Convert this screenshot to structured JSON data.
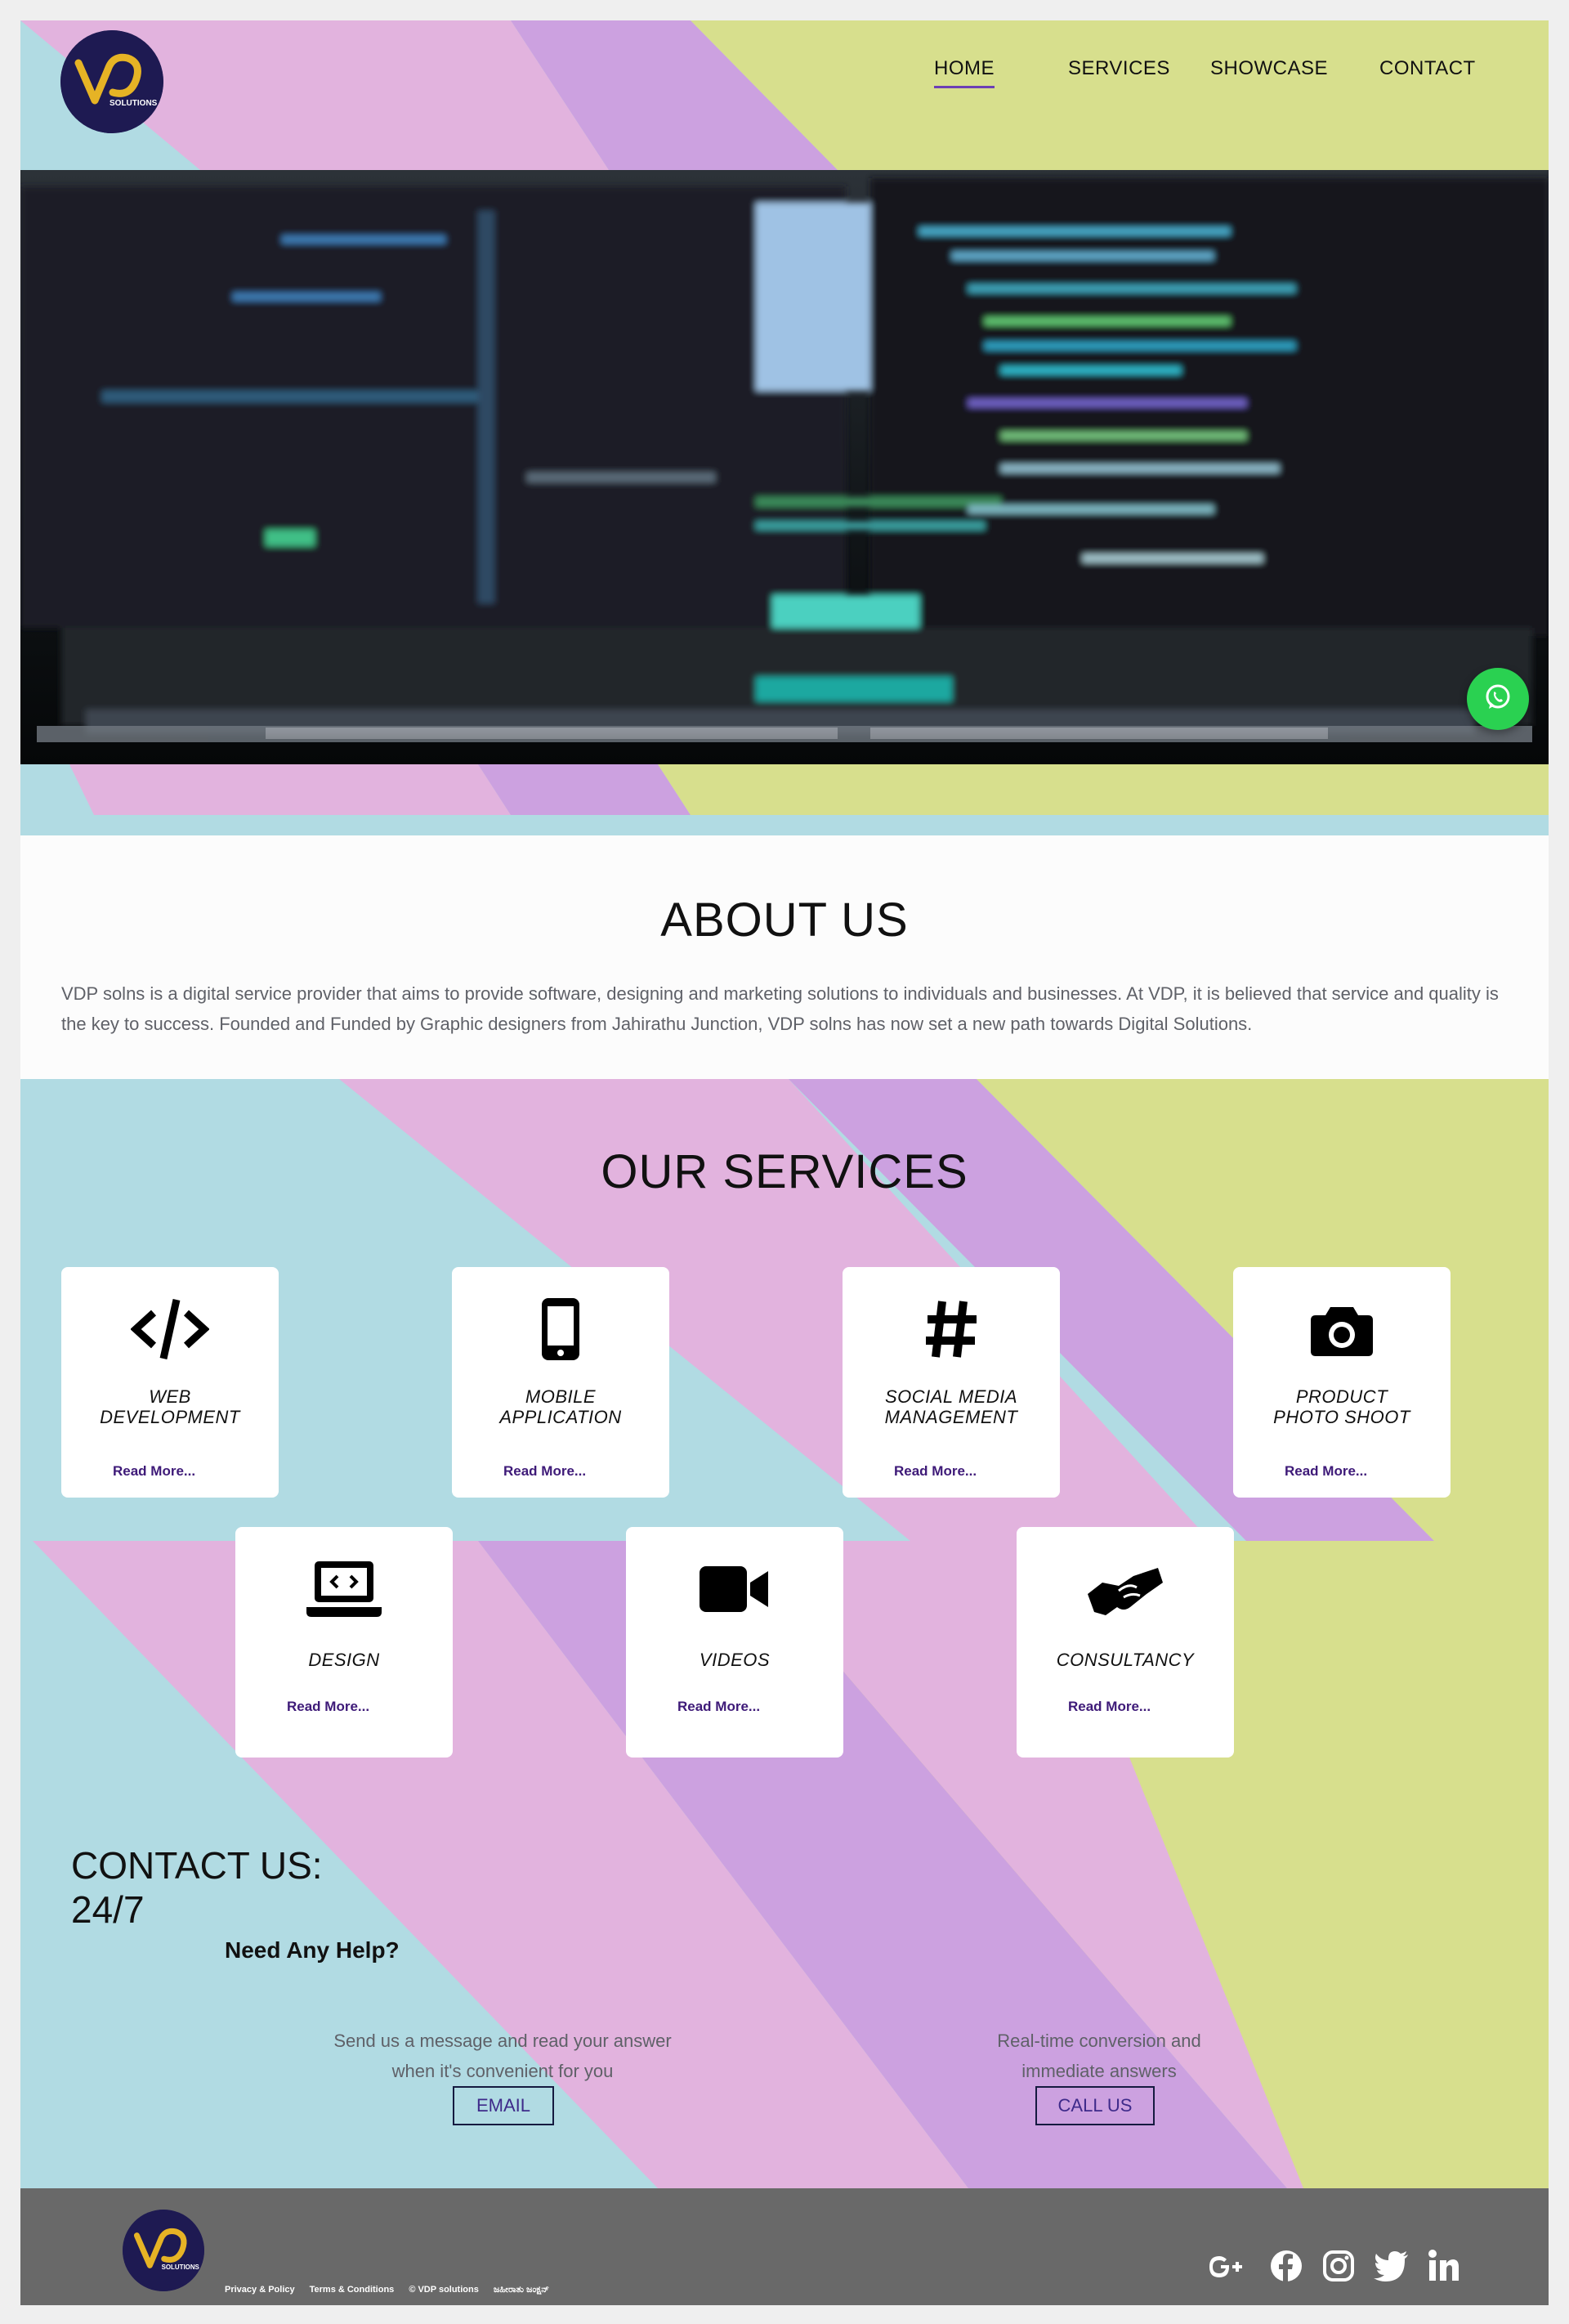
{
  "logo": {
    "text": "SOLUTIONS"
  },
  "nav": {
    "items": [
      {
        "label": "HOME",
        "active": true
      },
      {
        "label": "SERVICES",
        "active": false
      },
      {
        "label": "SHOWCASE",
        "active": false
      },
      {
        "label": "CONTACT",
        "active": false
      }
    ]
  },
  "about": {
    "title": "ABOUT US",
    "text": "VDP solns is a digital service provider that aims to provide software, designing and marketing solutions to individuals and businesses. At VDP, it is believed that service and quality is the key to success. Founded and Funded by Graphic designers from Jahirathu Junction, VDP solns has now set a new path towards Digital Solutions."
  },
  "services": {
    "title": "OUR SERVICES",
    "read_more": "Read More...",
    "cards": [
      {
        "name": "WEB\nDEVELOPMENT",
        "icon": "code-icon"
      },
      {
        "name": "MOBILE\nAPPLICATION",
        "icon": "mobile-phone-icon"
      },
      {
        "name": "SOCIAL MEDIA\nMANAGEMENT",
        "icon": "hashtag-icon"
      },
      {
        "name": "PRODUCT\nPHOTO SHOOT",
        "icon": "camera-icon"
      },
      {
        "name": "DESIGN",
        "icon": "laptop-code-icon"
      },
      {
        "name": "VIDEOS",
        "icon": "video-camera-icon"
      },
      {
        "name": "CONSULTANCY",
        "icon": "handshake-icon"
      }
    ]
  },
  "contact": {
    "title": "CONTACT US:\n24/7",
    "need_help": "Need Any Help?",
    "email_text": "Send us a message and read your answer when it's convenient for you",
    "email_button": "EMAIL",
    "call_text": "Real-time conversion and immediate answers",
    "call_button": "CALL US"
  },
  "footer": {
    "links": [
      "Privacy & Policy",
      "Terms & Conditions",
      "© VDP solutions",
      "ಜಹೀರಾತು ಜಂಕ್ಷನ್"
    ],
    "social": [
      "google-plus-icon",
      "facebook-icon",
      "instagram-icon",
      "twitter-icon",
      "linkedin-icon"
    ]
  },
  "colors": {
    "teal": "#b1dbe3",
    "pink": "#e2b3de",
    "purple": "#cca1e0",
    "lime": "#d7df8d",
    "navy": "#1e1a52",
    "whatsapp": "#2ad151",
    "footer": "#696969"
  }
}
